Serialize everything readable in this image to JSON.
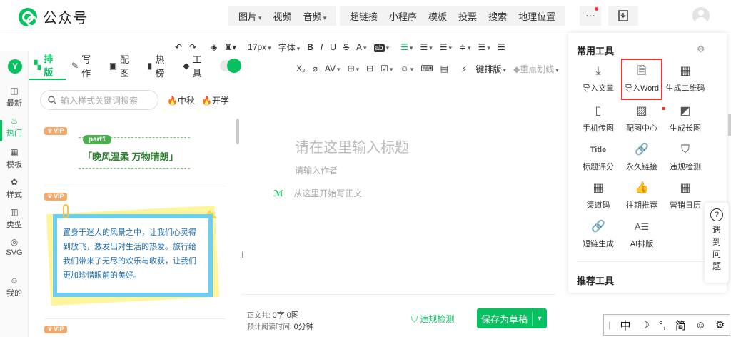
{
  "app": {
    "title": "公众号"
  },
  "top_insert_1": [
    "图片",
    "视频",
    "音频"
  ],
  "top_insert_2": [
    "超链接",
    "小程序",
    "模板",
    "投票",
    "搜索",
    "地理位置"
  ],
  "top_more": "···",
  "left_nav": {
    "logo": "Y",
    "items": [
      {
        "label": "最新",
        "icon": "latest-icon"
      },
      {
        "label": "热门",
        "icon": "hot-icon"
      },
      {
        "label": "模板",
        "icon": "template-icon"
      },
      {
        "label": "样式",
        "icon": "style-icon"
      },
      {
        "label": "类型",
        "icon": "type-icon"
      },
      {
        "label": "SVG",
        "icon": "svg-icon"
      },
      {
        "label": "我的",
        "icon": "mine-icon"
      }
    ]
  },
  "tabs": [
    {
      "label": "排版",
      "icon": "layout-icon"
    },
    {
      "label": "写作",
      "icon": "write-icon"
    },
    {
      "label": "配图",
      "icon": "image-icon"
    },
    {
      "label": "热榜",
      "icon": "hotlist-icon"
    },
    {
      "label": "工具",
      "icon": "tool-icon"
    }
  ],
  "search": {
    "placeholder": "输入样式关键词搜索"
  },
  "hot_tags": [
    "中秋",
    "开学"
  ],
  "style_cards": {
    "vip_label": "VIP",
    "card1": {
      "badge": "part1",
      "text": "「晚风温柔 万物晴朗」"
    },
    "card2": {
      "text": "置身于迷人的风景之中，让我们心灵得到放飞，激发出对生活的热爱。旅行给我们带来了无尽的欢乐与收获，让我们更加珍惜眼前的美好。"
    }
  },
  "toolbar": {
    "font_size": "17px",
    "font_family": "字体",
    "bold": "B",
    "italic": "I",
    "underline": "U",
    "strike": "S",
    "font_color": "A",
    "bg_color": "ab",
    "one_click": "一键排版",
    "highlight": "重点划线",
    "subscript": "X₂"
  },
  "editor": {
    "title_placeholder": "请在这里输入标题",
    "author_placeholder": "请输入作者",
    "body_placeholder": "从这里开始写正文"
  },
  "bottom": {
    "count_label": "正文共:",
    "count_value": "0字 0图",
    "read_label": "预计阅读时间:",
    "read_value": "0分钟",
    "check": "违规检测",
    "save": "保存为草稿"
  },
  "panel": {
    "title": "常用工具",
    "tools": [
      {
        "label": "导入文章",
        "icon": "download-icon"
      },
      {
        "label": "导入Word",
        "icon": "word-icon"
      },
      {
        "label": "生成二维码",
        "icon": "qrcode-icon"
      },
      {
        "label": "手机传图",
        "icon": "phone-upload-icon"
      },
      {
        "label": "配图中心",
        "icon": "picture-center-icon"
      },
      {
        "label": "生成长图",
        "icon": "long-image-icon"
      },
      {
        "label": "标题评分",
        "icon": "title-score-icon"
      },
      {
        "label": "永久链接",
        "icon": "link-icon"
      },
      {
        "label": "违规检测",
        "icon": "shield-icon"
      },
      {
        "label": "渠道码",
        "icon": "channel-code-icon"
      },
      {
        "label": "往期推荐",
        "icon": "thumb-up-icon"
      },
      {
        "label": "营销日历",
        "icon": "calendar-icon"
      },
      {
        "label": "短链生成",
        "icon": "short-link-icon"
      },
      {
        "label": "AI排版",
        "icon": "ai-layout-icon"
      }
    ],
    "sub_title": "推荐工具"
  },
  "help": {
    "chars": [
      "遇",
      "到",
      "问",
      "题"
    ]
  },
  "ime": [
    "中",
    "简"
  ],
  "colors": {
    "accent": "#07c160",
    "highlight_red": "#e53935"
  }
}
